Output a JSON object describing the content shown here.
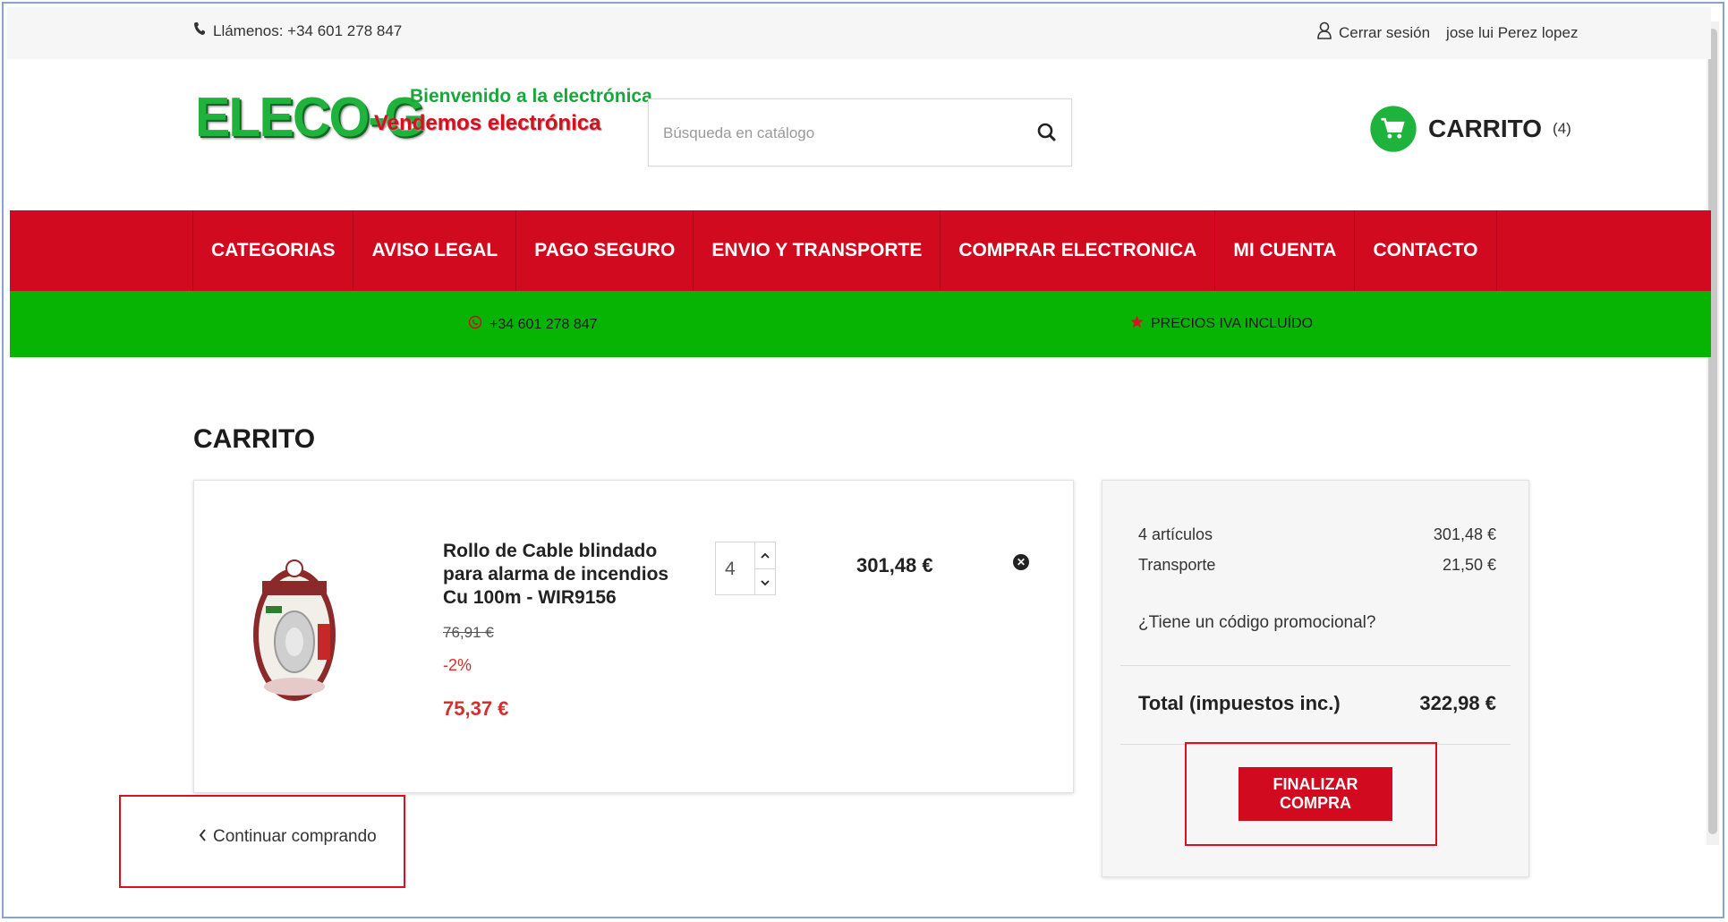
{
  "topbar": {
    "phone_label": "Llámenos: +34 601 278 847",
    "logout_label": "Cerrar sesión",
    "user_name": "jose lui Perez lopez"
  },
  "header": {
    "logo_brand": "ELECO-G",
    "logo_tagline_1": "Bienvenido a la electrónica",
    "logo_tagline_2": "Vendemos electrónica",
    "search_placeholder": "Búsqueda en catálogo",
    "cart_label": "CARRITO",
    "cart_count": "(4)"
  },
  "nav": {
    "items": [
      "CATEGORIAS",
      "AVISO LEGAL",
      "PAGO SEGURO",
      "ENVIO Y TRANSPORTE",
      "COMPRAR ELECTRONICA",
      "MI CUENTA",
      "CONTACTO"
    ]
  },
  "info_strip": {
    "phone": "+34 601 278 847",
    "tax_note": "PRECIOS IVA INCLUÍDO"
  },
  "cart_page": {
    "title": "CARRITO",
    "product": {
      "name": "Rollo de Cable blindado para alarma de incendios Cu 100m - WIR9156",
      "old_price": "76,91 €",
      "discount": "-2%",
      "price": "75,37 €",
      "quantity": "4",
      "line_total": "301,48 €"
    },
    "continue_label": "Continuar comprando"
  },
  "summary": {
    "items_label": "4 artículos",
    "items_value": "301,48 €",
    "shipping_label": "Transporte",
    "shipping_value": "21,50 €",
    "promo_label": "¿Tiene un código promocional?",
    "total_label": "Total (impuestos inc.)",
    "total_value": "322,98 €",
    "checkout_label": "FINALIZAR COMPRA"
  },
  "colors": {
    "nav_red": "#d10a1f",
    "strip_green": "#08b403",
    "cart_green": "#1db33c",
    "price_red": "#d32f2f"
  }
}
